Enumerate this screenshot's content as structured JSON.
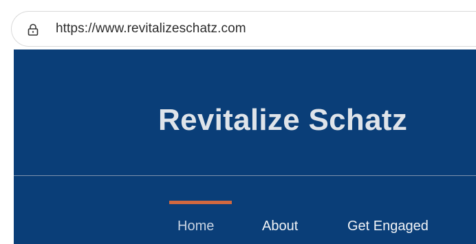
{
  "browser": {
    "url": "https://www.revitalizeschatz.com",
    "lock_icon": "lock-icon"
  },
  "site": {
    "title": "Revitalize Schatz",
    "colors": {
      "header_bg": "#0a3e78",
      "title": "#dfe4ea",
      "active_indicator": "#d2683f",
      "nav_text": "#f2f4f7",
      "nav_active_text": "#c9d4e3"
    },
    "nav": {
      "items": [
        {
          "label": "Home",
          "active": true
        },
        {
          "label": "About",
          "active": false
        },
        {
          "label": "Get Engaged",
          "active": false
        }
      ]
    }
  }
}
